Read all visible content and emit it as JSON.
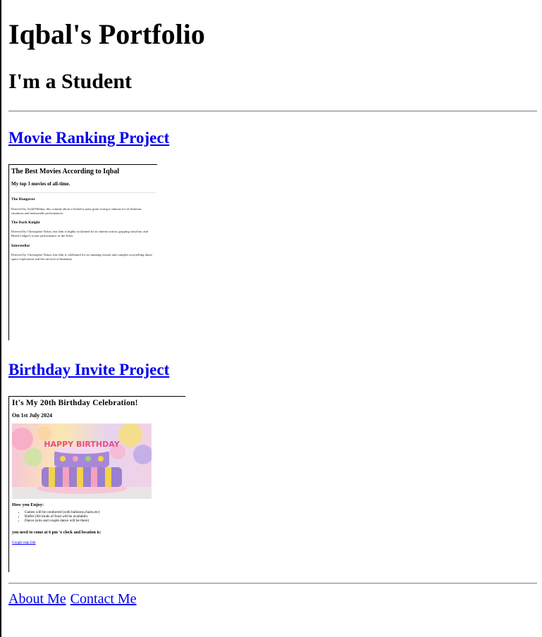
{
  "header": {
    "title": "Iqbal's Portfolio",
    "subtitle": "I'm a Student"
  },
  "projects": {
    "movie": {
      "link": "Movie Ranking Project",
      "preview": {
        "title": "The Best Movies According to Iqbal",
        "subtitle": "My top 3 movies of all-time.",
        "items": [
          {
            "name": "The Hangover",
            "desc": "Directed by Todd Phillips, this comedy about a bachelor party gone wrong is famous for its hilarious situations and memorable performances."
          },
          {
            "name": "The Dark Knight",
            "desc": "Directed by Christopher Nolan, this film is highly acclaimed for its intense action, gripping storyline, and Heath Ledger's iconic performance as the Joker."
          },
          {
            "name": "Interstellar",
            "desc": "Directed by Christopher Nolan, this film is celebrated for its stunning visuals and complex storytelling about space exploration and the survival of humanity."
          }
        ]
      }
    },
    "birthday": {
      "link": "Birthday Invite Project",
      "preview": {
        "title": "It's My 20th Birthday Celebration!",
        "date": "On 1st July 2024",
        "cake_text": "HAPPY BIRTHDAY",
        "enjoy_heading": "How you Enjoy:",
        "items": [
          "Games will be conducted (with balloons,chairs,etc)",
          "Buffet (All kinds of food will be available)",
          "Dance (solo and couple dance will be there)"
        ],
        "come_text": "you need to come at 6 pm 'o clock and location is:",
        "map_link": "Google map link"
      }
    }
  },
  "footer": {
    "about": "About Me",
    "contact": "Contact Me"
  },
  "colors": {
    "link": "#0000ee",
    "rule": "#8a8a8a"
  }
}
